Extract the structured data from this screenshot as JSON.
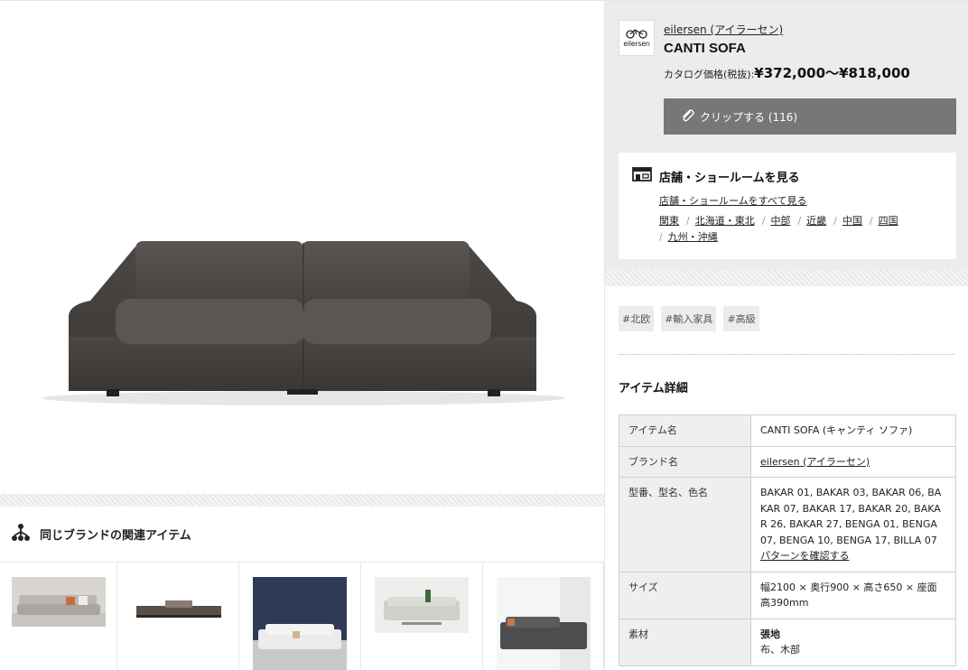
{
  "product": {
    "brand_link": "eilersen (アイラーセン)",
    "logo_text": "eilersen",
    "title": "CANTI SOFA",
    "price_label": "カタログ価格(税抜):",
    "price_value": "¥372,000〜¥818,000"
  },
  "clip_button": {
    "label": "クリップする (116)"
  },
  "showroom": {
    "title": "店舗・ショールームを見る",
    "all_link": "店舗・ショールームをすべて見る",
    "regions": [
      "関東",
      "北海道・東北",
      "中部",
      "近畿",
      "中国",
      "四国",
      "九州・沖縄"
    ]
  },
  "tags": [
    "#北欧",
    "#輸入家具",
    "#高級"
  ],
  "details": {
    "heading": "アイテム詳細",
    "rows": [
      {
        "key": "アイテム名",
        "value": "CANTI SOFA (キャンティ ソファ)"
      },
      {
        "key": "ブランド名",
        "value": "eilersen (アイラーセン)"
      },
      {
        "key": "型番、型名、色名",
        "value": "BAKAR 01, BAKAR 03, BAKAR 06, BAKAR 07, BAKAR 17, BAKAR 20, BAKAR 26, BAKAR 27, BENGA 01, BENGA 07, BENGA 10, BENGA 17, BILLA 07",
        "link": "パターンを確認する"
      },
      {
        "key": "サイズ",
        "value": "幅2100 × 奥行900 × 高さ650 × 座面高390mm"
      },
      {
        "key": "素材",
        "value": "張地",
        "value2": "布、木部"
      }
    ]
  },
  "related": {
    "title": "同じブランドの関連アイテム"
  },
  "colors": {
    "button_bg": "#777777",
    "header_bg": "#ececec",
    "sofa": "#4a4644"
  }
}
